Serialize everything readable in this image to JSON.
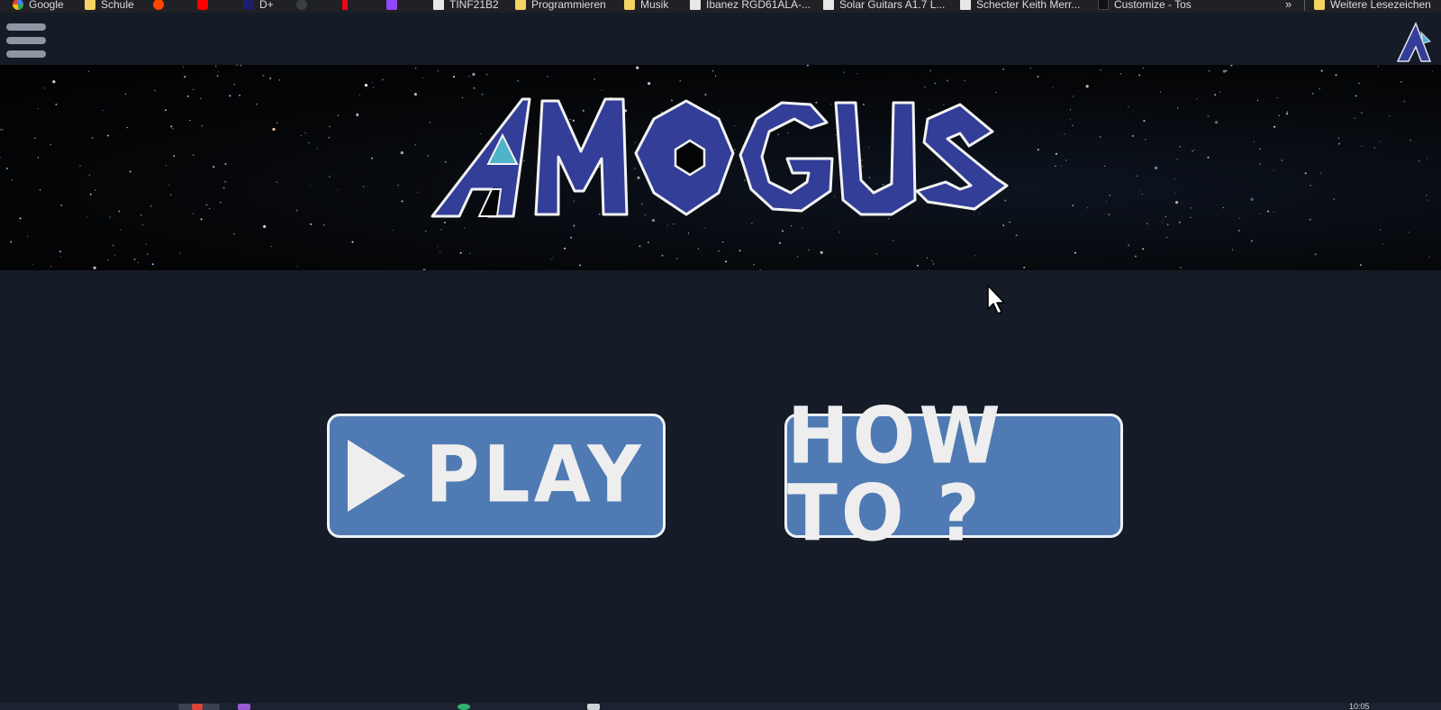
{
  "bookmarks": [
    {
      "label": "Google",
      "icon": "google-icon"
    },
    {
      "label": "Schule",
      "icon": "folder-icon"
    },
    {
      "label": "",
      "icon": "reddit-icon"
    },
    {
      "label": "",
      "icon": "youtube-icon"
    },
    {
      "label": "D+",
      "icon": "disney-plus-icon"
    },
    {
      "label": "",
      "icon": "github-icon"
    },
    {
      "label": "",
      "icon": "netflix-icon"
    },
    {
      "label": "",
      "icon": "twitch-icon"
    },
    {
      "label": "TINF21B2",
      "icon": "site-icon"
    },
    {
      "label": "Programmieren",
      "icon": "folder-icon"
    },
    {
      "label": "Musik",
      "icon": "folder-icon"
    },
    {
      "label": "Ibanez RGD61ALA-...",
      "icon": "site-icon"
    },
    {
      "label": "Solar Guitars A1.7 L...",
      "icon": "site-icon"
    },
    {
      "label": "Schecter Keith Merr...",
      "icon": "site-icon"
    },
    {
      "label": "Customize - Tos",
      "icon": "site-icon"
    }
  ],
  "bookmarks_more": "»",
  "other_bookmarks": "Weitere Lesezeichen",
  "nav": {
    "menu_icon": "hamburger-menu-icon",
    "logo_icon": "app-logo-icon"
  },
  "banner": {
    "logo_text": "AMOGUS"
  },
  "buttons": {
    "play_label": "PLAY",
    "howto_label": "HOW TO ?"
  },
  "clock": "10:05",
  "colors": {
    "background": "#151b27",
    "button_fill": "#4f7ab3",
    "logo_fill": "#323e97",
    "accent_teal": "#4fb3c9"
  }
}
